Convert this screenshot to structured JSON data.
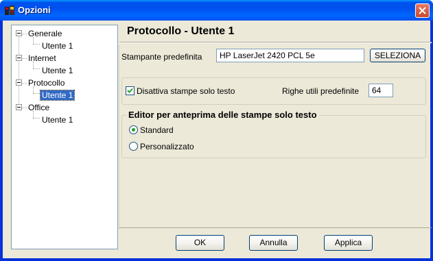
{
  "window": {
    "title": "Opzioni"
  },
  "tree": [
    {
      "label": "Generale",
      "children": [
        "Utente 1"
      ]
    },
    {
      "label": "Internet",
      "children": [
        "Utente 1"
      ]
    },
    {
      "label": "Protocollo",
      "children": [
        "Utente 1"
      ]
    },
    {
      "label": "Office",
      "children": [
        "Utente 1"
      ]
    }
  ],
  "page": {
    "title": "Protocollo - Utente  1"
  },
  "printer": {
    "label": "Stampante predefinita",
    "value": "HP LaserJet 2420 PCL 5e",
    "select_label": "SELEZIONA"
  },
  "text_print": {
    "checkbox_label": "Disattiva stampe solo testo",
    "checked": true,
    "lines_label": "Righe utili predefinite",
    "lines_value": "64"
  },
  "editor_group": {
    "title": "Editor per anteprima delle stampe solo testo",
    "options": [
      {
        "label": "Standard",
        "selected": true
      },
      {
        "label": "Personalizzato",
        "selected": false
      }
    ]
  },
  "buttons": {
    "ok": "OK",
    "cancel": "Annulla",
    "apply": "Applica"
  },
  "colors": {
    "titlebar": "#0054e3",
    "selection": "#316ac5",
    "dialog": "#ece9d8",
    "close": "#d6502e"
  }
}
